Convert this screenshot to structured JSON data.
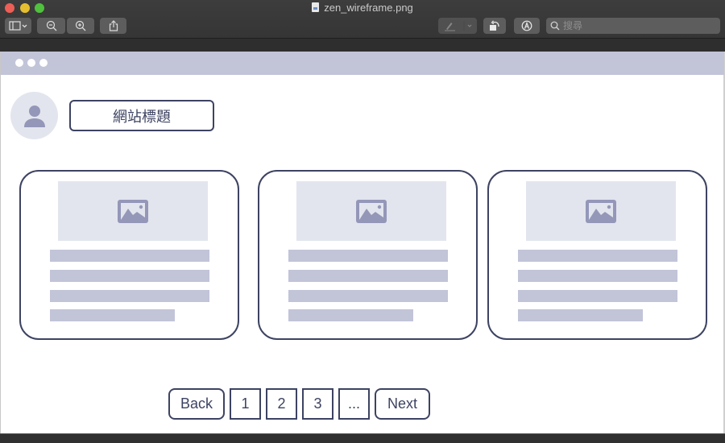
{
  "window": {
    "title": "zen_wireframe.png",
    "search_placeholder": "搜尋"
  },
  "toolbar": {
    "buttons": [
      {
        "name": "sidebar-toggle",
        "icon": "sidebar-icon"
      },
      {
        "name": "zoom-out",
        "icon": "zoom-out-icon"
      },
      {
        "name": "zoom-in",
        "icon": "zoom-in-icon"
      },
      {
        "name": "share",
        "icon": "share-icon"
      },
      {
        "name": "markup",
        "icon": "pen-icon"
      },
      {
        "name": "rotate",
        "icon": "rotate-icon"
      },
      {
        "name": "annotate",
        "icon": "annotate-icon"
      }
    ]
  },
  "wireframe": {
    "site_title": "網站標題",
    "cards": [
      {
        "image": "image-placeholder-icon",
        "text_lines": 4
      },
      {
        "image": "image-placeholder-icon",
        "text_lines": 4
      },
      {
        "image": "image-placeholder-icon",
        "text_lines": 4
      }
    ],
    "pagination": {
      "back": "Back",
      "pages": [
        "1",
        "2",
        "3"
      ],
      "ellipsis": "...",
      "next": "Next"
    },
    "colors": {
      "stroke": "#3d4362",
      "placeholder_fill": "#e3e5ee",
      "text_line_fill": "#c2c4d8",
      "icon_fill": "#9497b8"
    }
  }
}
